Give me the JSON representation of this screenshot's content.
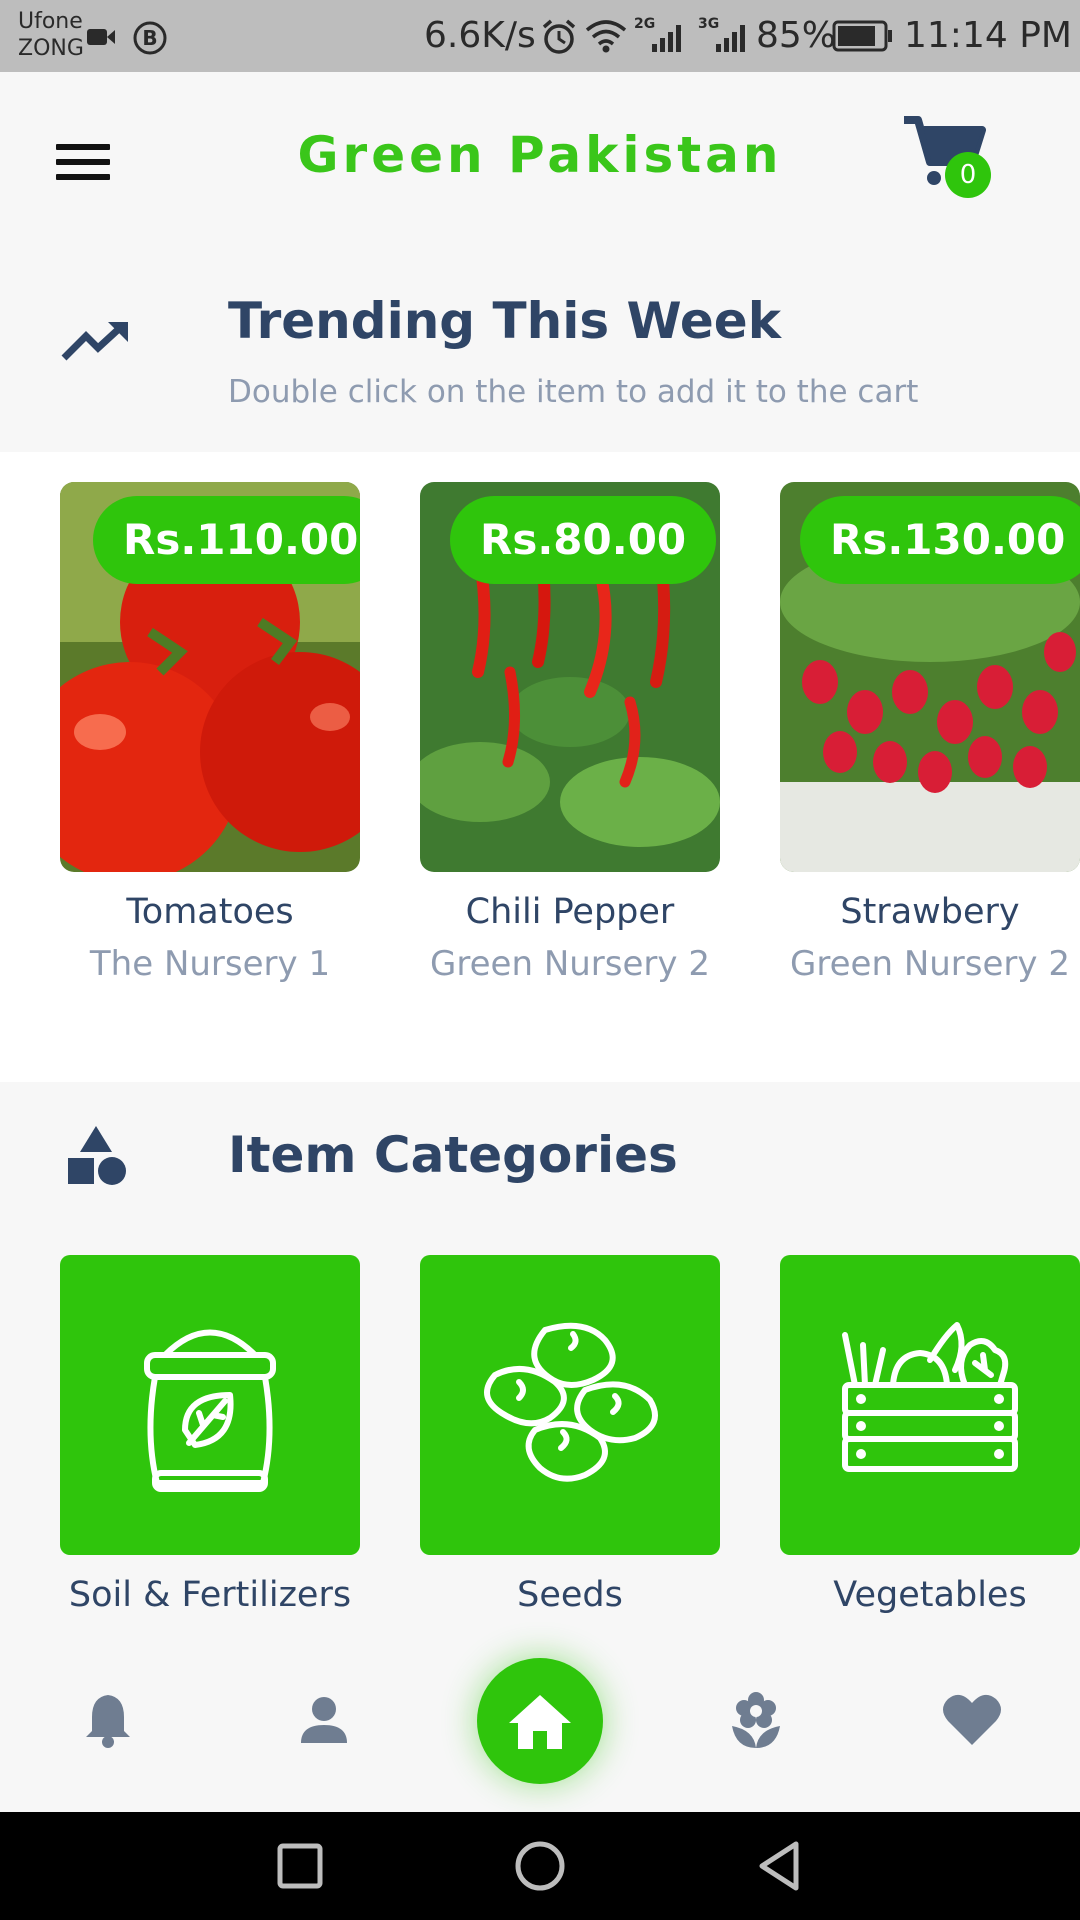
{
  "status_bar": {
    "carrier_1": "Ufone",
    "carrier_2": "ZONG",
    "speed": "6.6K/s",
    "network_1": "2G",
    "network_2": "3G",
    "battery": "85%",
    "time": "11:14 PM",
    "battery_level": 0.85,
    "icons": [
      "video-icon",
      "b-icon",
      "alarm-icon",
      "wifi-icon",
      "signal-icon",
      "battery-icon"
    ]
  },
  "header": {
    "title": "Green Pakistan",
    "cart_count": "0",
    "menu_icon": "hamburger-icon",
    "cart_icon": "cart-icon"
  },
  "trending": {
    "title": "Trending This Week",
    "subtitle": "Double click on the item to add it to the cart",
    "icon": "trending-up-icon",
    "items": [
      {
        "name": "Tomatoes",
        "shop": "The Nursery 1",
        "price": "Rs.110.00"
      },
      {
        "name": "Chili Pepper",
        "shop": "Green Nursery 2",
        "price": "Rs.80.00"
      },
      {
        "name": "Strawbery",
        "shop": "Green Nursery 2",
        "price": "Rs.130.00"
      }
    ]
  },
  "categories": {
    "title": "Item Categories",
    "icon": "shapes-icon",
    "items": [
      {
        "label": "Soil & Fertilizers",
        "icon": "fertilizer-bag-icon"
      },
      {
        "label": "Seeds",
        "icon": "seeds-icon"
      },
      {
        "label": "Vegetables",
        "icon": "vegetable-crate-icon"
      }
    ]
  },
  "bottom_nav": {
    "icons": [
      "bell-icon",
      "person-icon",
      "home-icon",
      "flower-icon",
      "heart-icon"
    ],
    "active": "home-icon"
  },
  "system_nav": {
    "icons": [
      "recents-icon",
      "home-circle-icon",
      "back-icon"
    ]
  },
  "colors": {
    "brand_green": "#2fc50c",
    "title_green": "#3ac61a",
    "text_dark": "#2f4566",
    "text_muted": "#8e9bb0",
    "nav_gray": "#6f7d91"
  }
}
